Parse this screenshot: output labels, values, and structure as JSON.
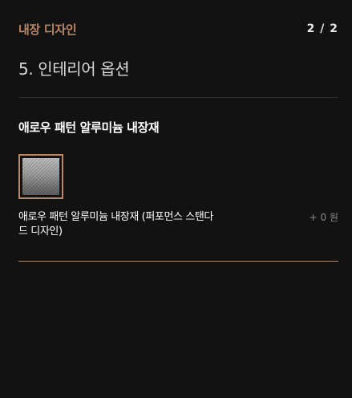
{
  "header": {
    "section_label": "내장 디자인",
    "step_indicator": "2 / 2"
  },
  "page_title": "5. 인테리어 옵션",
  "option_group": {
    "title": "애로우 패턴 알루미늄 내장재",
    "options": [
      {
        "name": "애로우 패턴 알루미늄 내장재 (퍼포먼스 스탠다드 디자인)",
        "price": "+ 0 원",
        "selected": true,
        "swatch_icon": "brushed-aluminum-texture"
      }
    ]
  },
  "colors": {
    "accent": "#b98766",
    "background": "#121212",
    "text_primary": "#ffffff",
    "text_muted": "#8a8a8a"
  }
}
